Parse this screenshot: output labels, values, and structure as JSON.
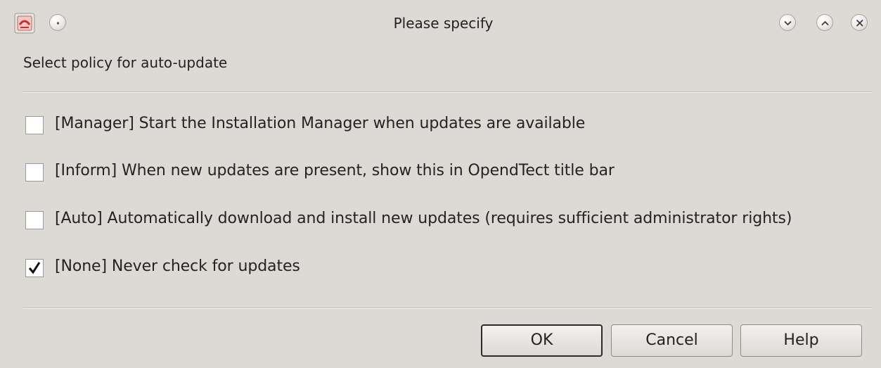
{
  "window": {
    "title": "Please specify"
  },
  "dialog": {
    "prompt": "Select policy for auto-update",
    "options": [
      {
        "label": "[Manager] Start the Installation Manager when updates are available",
        "checked": false
      },
      {
        "label": "[Inform] When new updates are present, show this in OpendTect title bar",
        "checked": false
      },
      {
        "label": "[Auto] Automatically download and install new updates (requires sufficient administrator rights)",
        "checked": false
      },
      {
        "label": "[None] Never check for updates",
        "checked": true
      }
    ]
  },
  "buttons": {
    "ok": "OK",
    "cancel": "Cancel",
    "help": "Help"
  },
  "icons": {
    "app": "app-icon",
    "menu": "window-menu-icon",
    "minimize": "minimize-icon",
    "maximize": "maximize-icon",
    "close": "close-icon",
    "check": "checkmark-icon"
  },
  "colors": {
    "background": "#dddad6",
    "app_icon_red": "#c8302a"
  }
}
